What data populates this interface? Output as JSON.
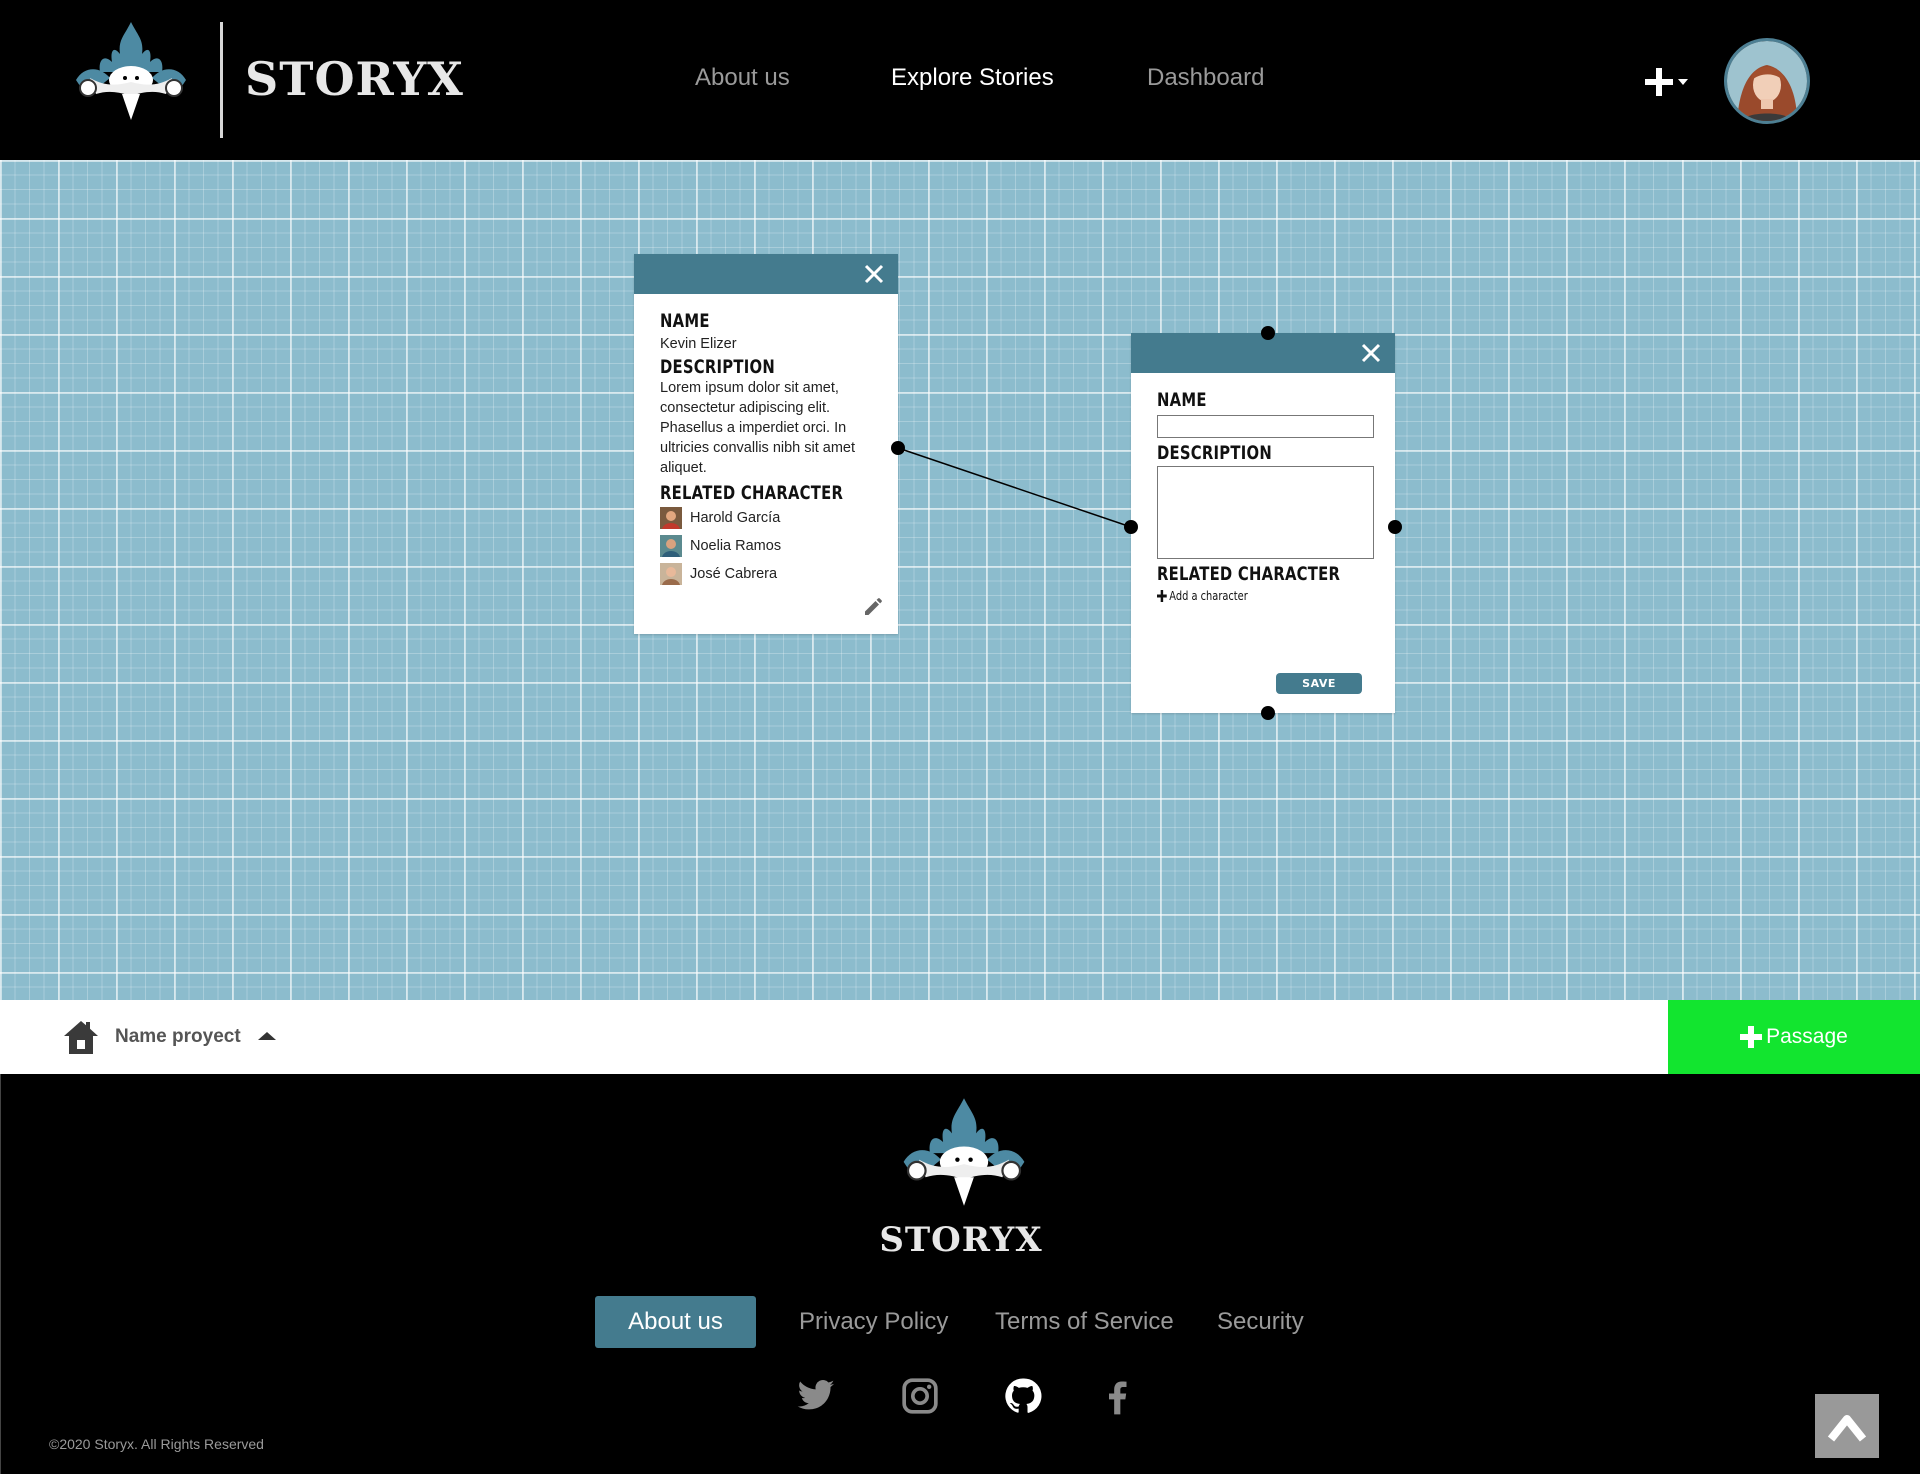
{
  "header": {
    "brand": "STORYX",
    "nav": [
      {
        "label": "About us",
        "active": false
      },
      {
        "label": "Explore Stories",
        "active": true
      },
      {
        "label": "Dashboard",
        "active": false
      }
    ],
    "add_icon": "plus-icon",
    "dropdown_icon": "caret-down-icon"
  },
  "canvas": {
    "character_card": {
      "name_label": "NAME",
      "name_value": "Kevin Elizer",
      "description_label": "DESCRIPTION",
      "description_value": "Lorem ipsum dolor sit amet, consectetur adipiscing elit. Phasellus a imperdiet orci. In ultricies convallis nibh sit amet aliquet.",
      "related_label": "RELATED CHARACTER",
      "related": [
        "Harold García",
        "Noelia Ramos",
        "José Cabrera"
      ]
    },
    "edit_card": {
      "name_label": "NAME",
      "name_value": "",
      "description_label": "DESCRIPTION",
      "description_value": "",
      "related_label": "RELATED CHARACTER",
      "add_character_label": "Add a character",
      "save_label": "SAVE"
    }
  },
  "project_bar": {
    "project_name": "Name proyect",
    "passage_label": "Passage"
  },
  "footer": {
    "brand": "STORYX",
    "links": [
      "About us",
      "Privacy Policy",
      "Terms of Service",
      "Security"
    ],
    "social": [
      "twitter-icon",
      "instagram-icon",
      "github-icon",
      "facebook-icon"
    ],
    "copyright": "©2020 Storyx. All Rights Reserved"
  },
  "colors": {
    "accent": "#447b8e",
    "canvas": "#8cbccd",
    "passage": "#12e52f",
    "background": "#000000"
  }
}
